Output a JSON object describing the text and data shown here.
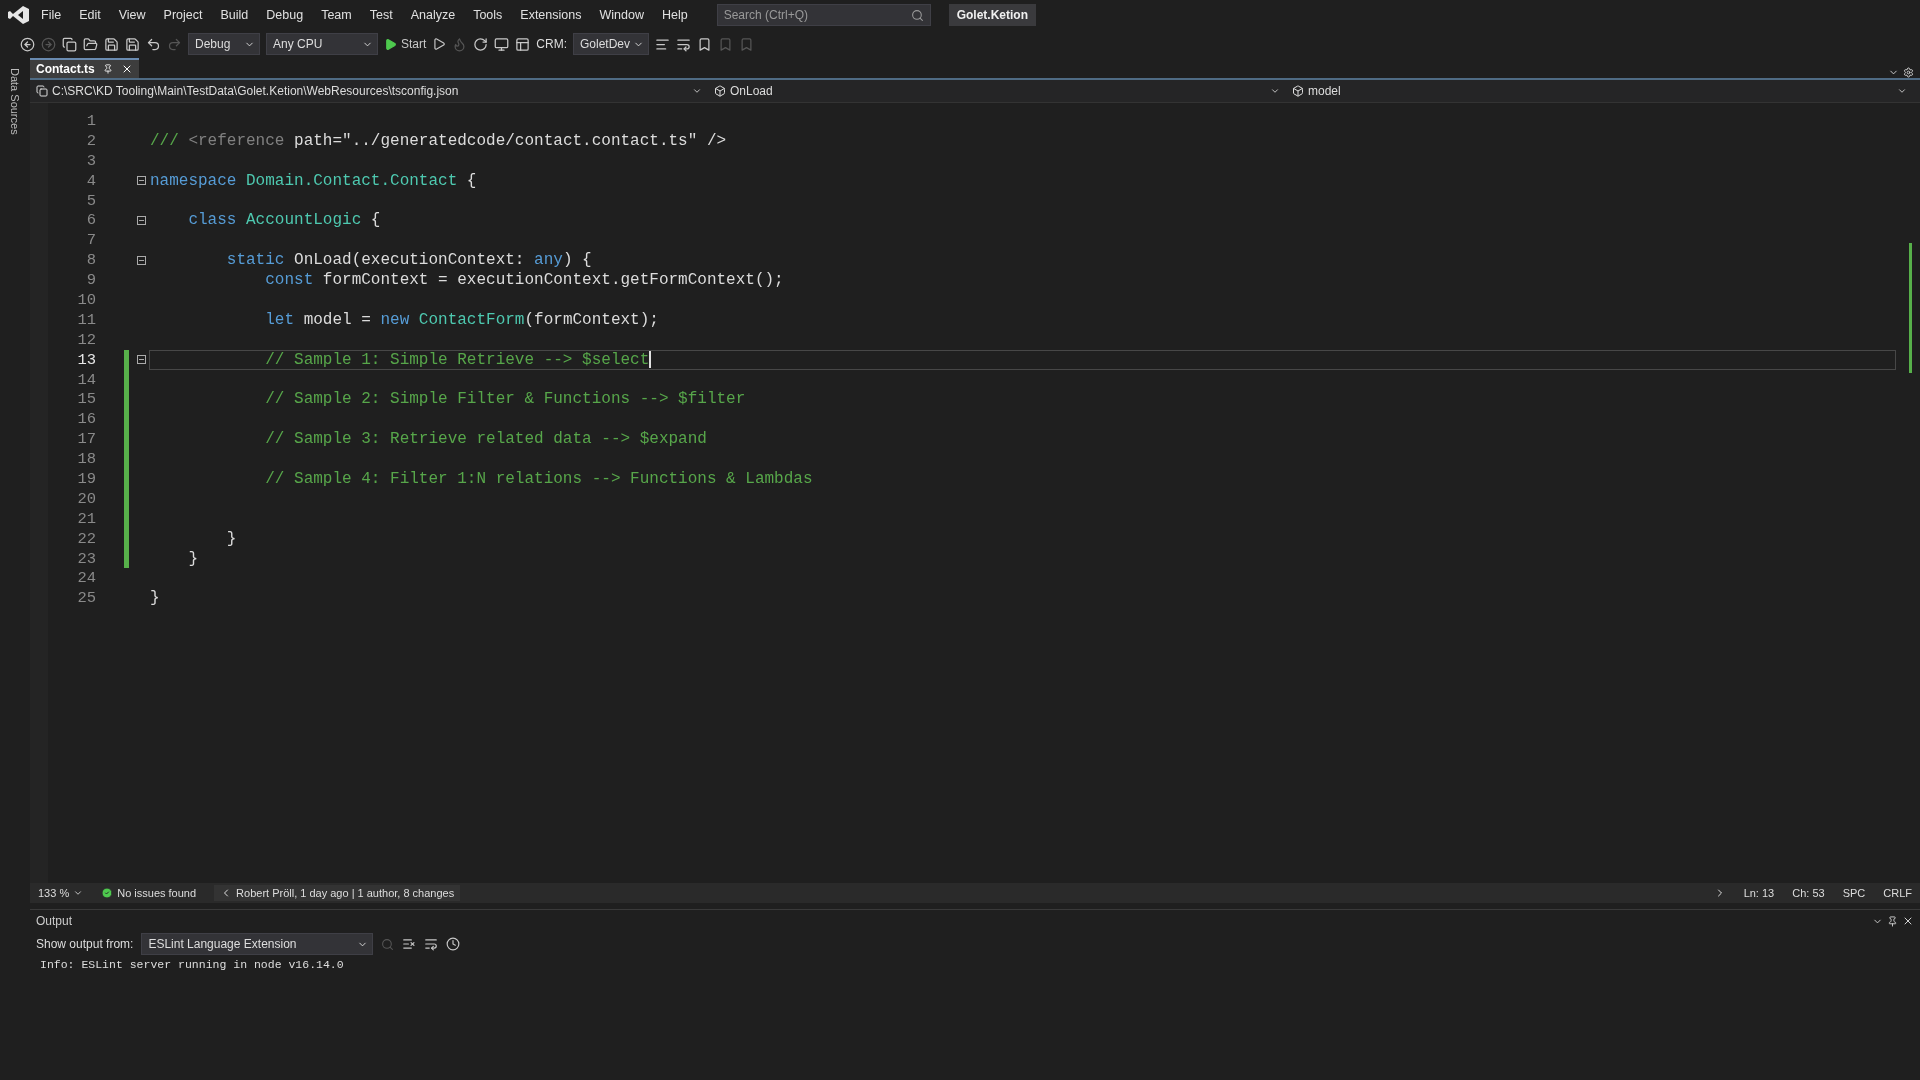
{
  "menu": [
    "File",
    "Edit",
    "View",
    "Project",
    "Build",
    "Debug",
    "Team",
    "Test",
    "Analyze",
    "Tools",
    "Extensions",
    "Window",
    "Help"
  ],
  "search": {
    "placeholder": "Search (Ctrl+Q)"
  },
  "solution_badge": "Golet.Ketion",
  "toolbar": {
    "configuration": "Debug",
    "platform": "Any CPU",
    "start": "Start",
    "crm_label": "CRM:",
    "crm_value": "GoletDev"
  },
  "side_tab": "Data Sources",
  "document_tab": {
    "title": "Contact.ts",
    "selected": true
  },
  "nav_bar": {
    "project": "C:\\SRC\\KD Tooling\\Main\\TestData\\Golet.Ketion\\WebResources\\tsconfig.json",
    "member": "OnLoad",
    "symbol": "model"
  },
  "code_lines": [
    {
      "number": "1",
      "changed": false,
      "fold": false,
      "current": false
    },
    {
      "number": "2",
      "tokens": [
        {
          "kind": "comment",
          "text": "/// "
        },
        {
          "kind": "tag",
          "text": "<reference "
        },
        {
          "kind": "plain",
          "text": "path=\"../generatedcode/contact.contact.ts\" />"
        }
      ],
      "changed": false,
      "fold": false,
      "current": false
    },
    {
      "number": "3",
      "changed": false,
      "fold": false,
      "current": false
    },
    {
      "number": "4",
      "tokens": [
        {
          "kind": "keyword",
          "text": "namespace "
        },
        {
          "kind": "type",
          "text": "Domain.Contact.Contact"
        },
        {
          "kind": "plain",
          "text": " {"
        }
      ],
      "changed": false,
      "fold": true,
      "current": false
    },
    {
      "number": "5",
      "changed": false,
      "fold": false,
      "current": false
    },
    {
      "number": "6",
      "tokens": [
        {
          "kind": "keyword",
          "text": "    class "
        },
        {
          "kind": "type",
          "text": "AccountLogic"
        },
        {
          "kind": "plain",
          "text": " {"
        }
      ],
      "changed": false,
      "fold": true,
      "current": false
    },
    {
      "number": "7",
      "changed": false,
      "fold": false,
      "current": false
    },
    {
      "number": "8",
      "tokens": [
        {
          "kind": "keyword",
          "text": "        static "
        },
        {
          "kind": "plain",
          "text": "OnLoad(executionContext: "
        },
        {
          "kind": "keyword",
          "text": "any"
        },
        {
          "kind": "plain",
          "text": ") {"
        }
      ],
      "changed": false,
      "fold": true,
      "current": false
    },
    {
      "number": "9",
      "tokens": [
        {
          "kind": "keyword",
          "text": "            const "
        },
        {
          "kind": "plain",
          "text": "formContext = executionContext.getFormContext();"
        }
      ],
      "changed": false,
      "fold": false,
      "current": false
    },
    {
      "number": "10",
      "changed": false,
      "fold": false,
      "current": false
    },
    {
      "number": "11",
      "tokens": [
        {
          "kind": "keyword",
          "text": "            let "
        },
        {
          "kind": "plain",
          "text": "model = "
        },
        {
          "kind": "keyword",
          "text": "new "
        },
        {
          "kind": "type",
          "text": "ContactForm"
        },
        {
          "kind": "plain",
          "text": "(formContext);"
        }
      ],
      "changed": false,
      "fold": false,
      "current": false
    },
    {
      "number": "12",
      "changed": false,
      "fold": false,
      "current": false
    },
    {
      "number": "13",
      "tokens": [
        {
          "kind": "comment",
          "text": "            // Sample 1: Simple Retrieve --> $select"
        }
      ],
      "changed": true,
      "fold": true,
      "current": true
    },
    {
      "number": "14",
      "changed": true,
      "fold": false,
      "current": false
    },
    {
      "number": "15",
      "tokens": [
        {
          "kind": "comment",
          "text": "            // Sample 2: Simple Filter & Functions --> $filter"
        }
      ],
      "changed": true,
      "fold": false,
      "current": false
    },
    {
      "number": "16",
      "changed": true,
      "fold": false,
      "current": false
    },
    {
      "number": "17",
      "tokens": [
        {
          "kind": "comment",
          "text": "            // Sample 3: Retrieve related data --> $expand"
        }
      ],
      "changed": true,
      "fold": false,
      "current": false
    },
    {
      "number": "18",
      "changed": true,
      "fold": false,
      "current": false
    },
    {
      "number": "19",
      "tokens": [
        {
          "kind": "comment",
          "text": "            // Sample 4: Filter 1:N relations --> Functions & Lambdas"
        }
      ],
      "changed": true,
      "fold": false,
      "current": false
    },
    {
      "number": "20",
      "changed": true,
      "fold": false,
      "current": false
    },
    {
      "number": "21",
      "changed": true,
      "fold": false,
      "current": false
    },
    {
      "number": "22",
      "tokens": [
        {
          "kind": "plain",
          "text": "        }"
        }
      ],
      "changed": true,
      "fold": false,
      "current": false
    },
    {
      "number": "23",
      "tokens": [
        {
          "kind": "plain",
          "text": "    }"
        }
      ],
      "changed": true,
      "fold": false,
      "current": false
    },
    {
      "number": "24",
      "changed": false,
      "fold": false,
      "current": false
    },
    {
      "number": "25",
      "tokens": [
        {
          "kind": "plain",
          "text": "}"
        }
      ],
      "changed": false,
      "fold": false,
      "current": false
    }
  ],
  "status_bar": {
    "zoom": "133 %",
    "issues": "No issues found",
    "blame": "Robert Pröll, 1 day ago | 1 author, 8 changes",
    "line": "Ln: 13",
    "column": "Ch: 53",
    "whitespace": "SPC",
    "line_endings": "CRLF"
  },
  "output": {
    "title": "Output",
    "source_label": "Show output from:",
    "source": "ESLint Language Extension",
    "lines": [
      "Info: ESLint server running in node v16.14.0"
    ]
  }
}
